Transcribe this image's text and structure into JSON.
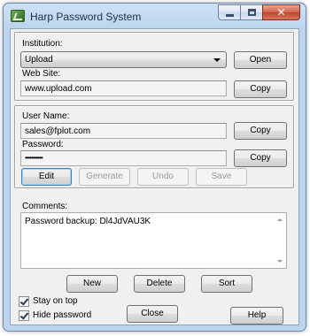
{
  "window": {
    "title": "Harp Password System"
  },
  "institution": {
    "label": "Institution:",
    "selected": "Upload",
    "open_label": "Open",
    "website_label": "Web Site:",
    "website_value": "www.upload.com",
    "copy_label": "Copy"
  },
  "account": {
    "username_label": "User Name:",
    "username_value": "sales@fplot.com",
    "username_copy_label": "Copy",
    "password_label": "Password:",
    "password_value": "•••••••••••",
    "password_copy_label": "Copy",
    "edit_label": "Edit",
    "generate_label": "Generate",
    "undo_label": "Undo",
    "save_label": "Save"
  },
  "comments": {
    "label": "Comments:",
    "text": "Password backup: Dl4JdVAU3K"
  },
  "actions": {
    "new_label": "New",
    "delete_label": "Delete",
    "sort_label": "Sort",
    "close_label": "Close",
    "help_label": "Help"
  },
  "options": {
    "stay_on_top_label": "Stay on top",
    "stay_on_top_checked": true,
    "hide_password_label": "Hide password",
    "hide_password_checked": true
  }
}
